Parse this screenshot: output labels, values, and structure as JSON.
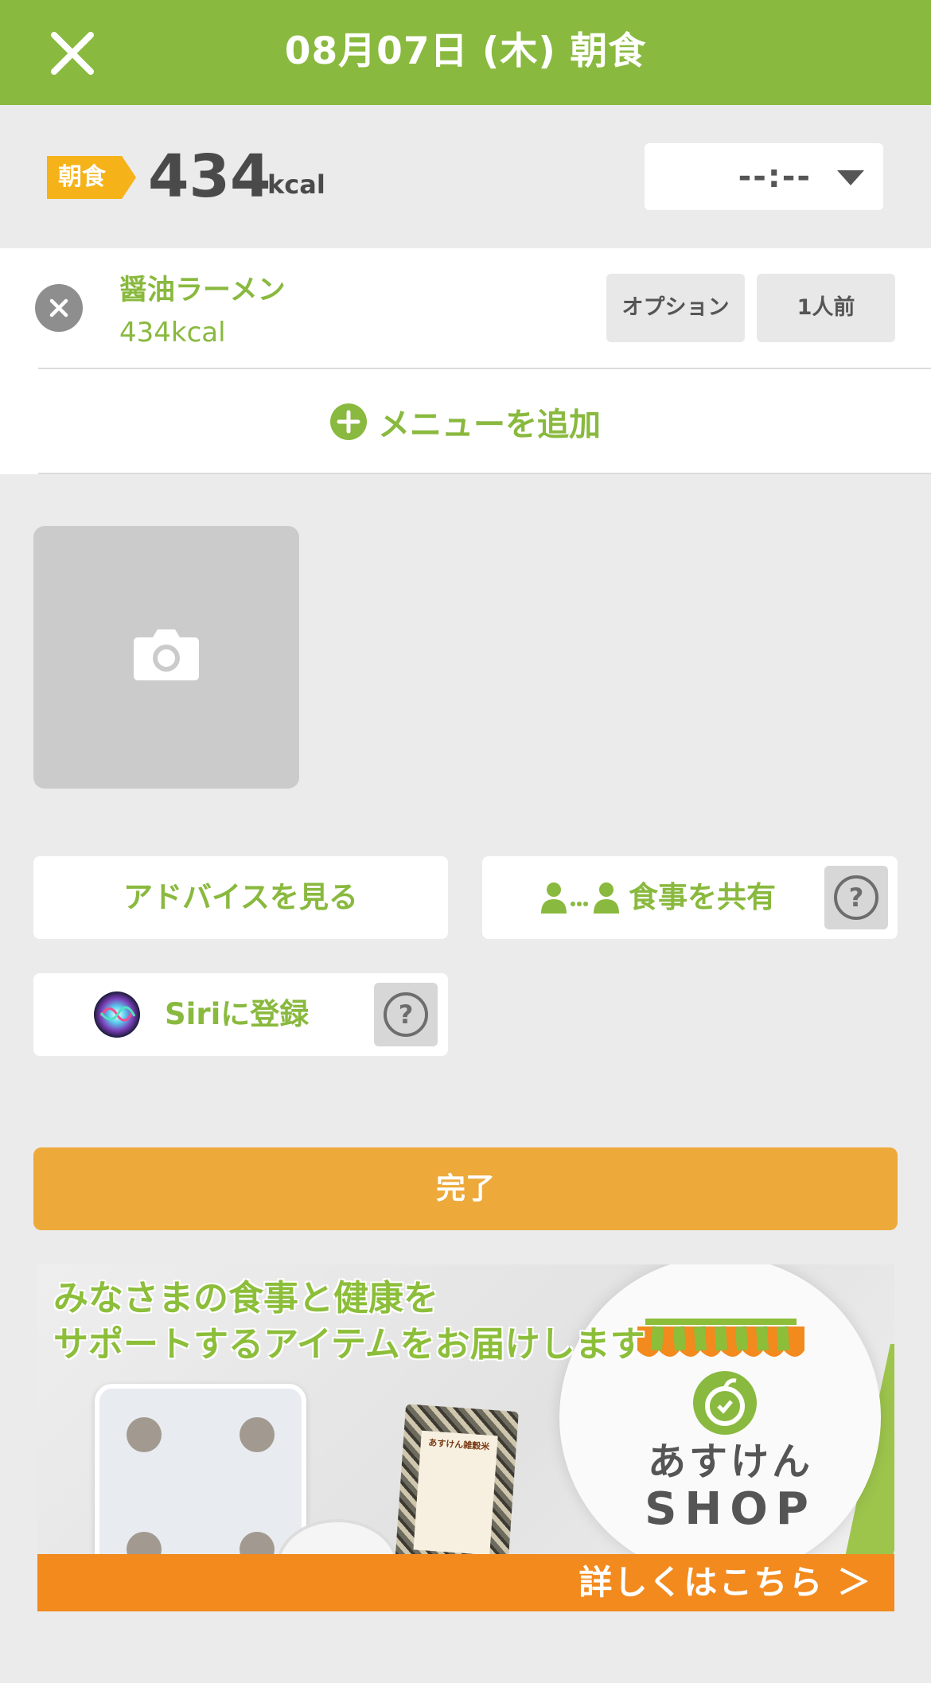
{
  "header": {
    "title": "08月07日 (木) 朝食",
    "close_icon": "close-icon"
  },
  "summary": {
    "meal_tag": "朝食",
    "calories": "434",
    "unit": "kcal",
    "time_value": "--:--",
    "time_icon": "chevron-down-icon"
  },
  "items": [
    {
      "name": "醤油ラーメン",
      "kcal": "434kcal",
      "option_label": "オプション",
      "serving_label": "1人前"
    }
  ],
  "add_menu": {
    "label": "メニューを追加",
    "icon": "plus-circle-icon"
  },
  "photo": {
    "icon": "camera-icon"
  },
  "actions": {
    "advice": "アドバイスを見る",
    "share": "食事を共有",
    "share_icon": "share-people-icon",
    "siri": "Siriに登録",
    "siri_icon": "siri-icon",
    "help_icon": "question-circle-icon"
  },
  "done": {
    "label": "完了"
  },
  "banner": {
    "headline_line1": "みなさまの食事と健康を",
    "headline_line2": "サポートするアイテムをお届けします",
    "shop_name": "あすけん",
    "shop_sub": "SHOP",
    "pack_title": "あすけん雑穀米",
    "cta": "詳しくはこちら ＞"
  },
  "colors": {
    "brand_green": "#89b93e",
    "tag_yellow": "#f6b219",
    "done_orange": "#eda93a",
    "background": "#ebebeb"
  }
}
